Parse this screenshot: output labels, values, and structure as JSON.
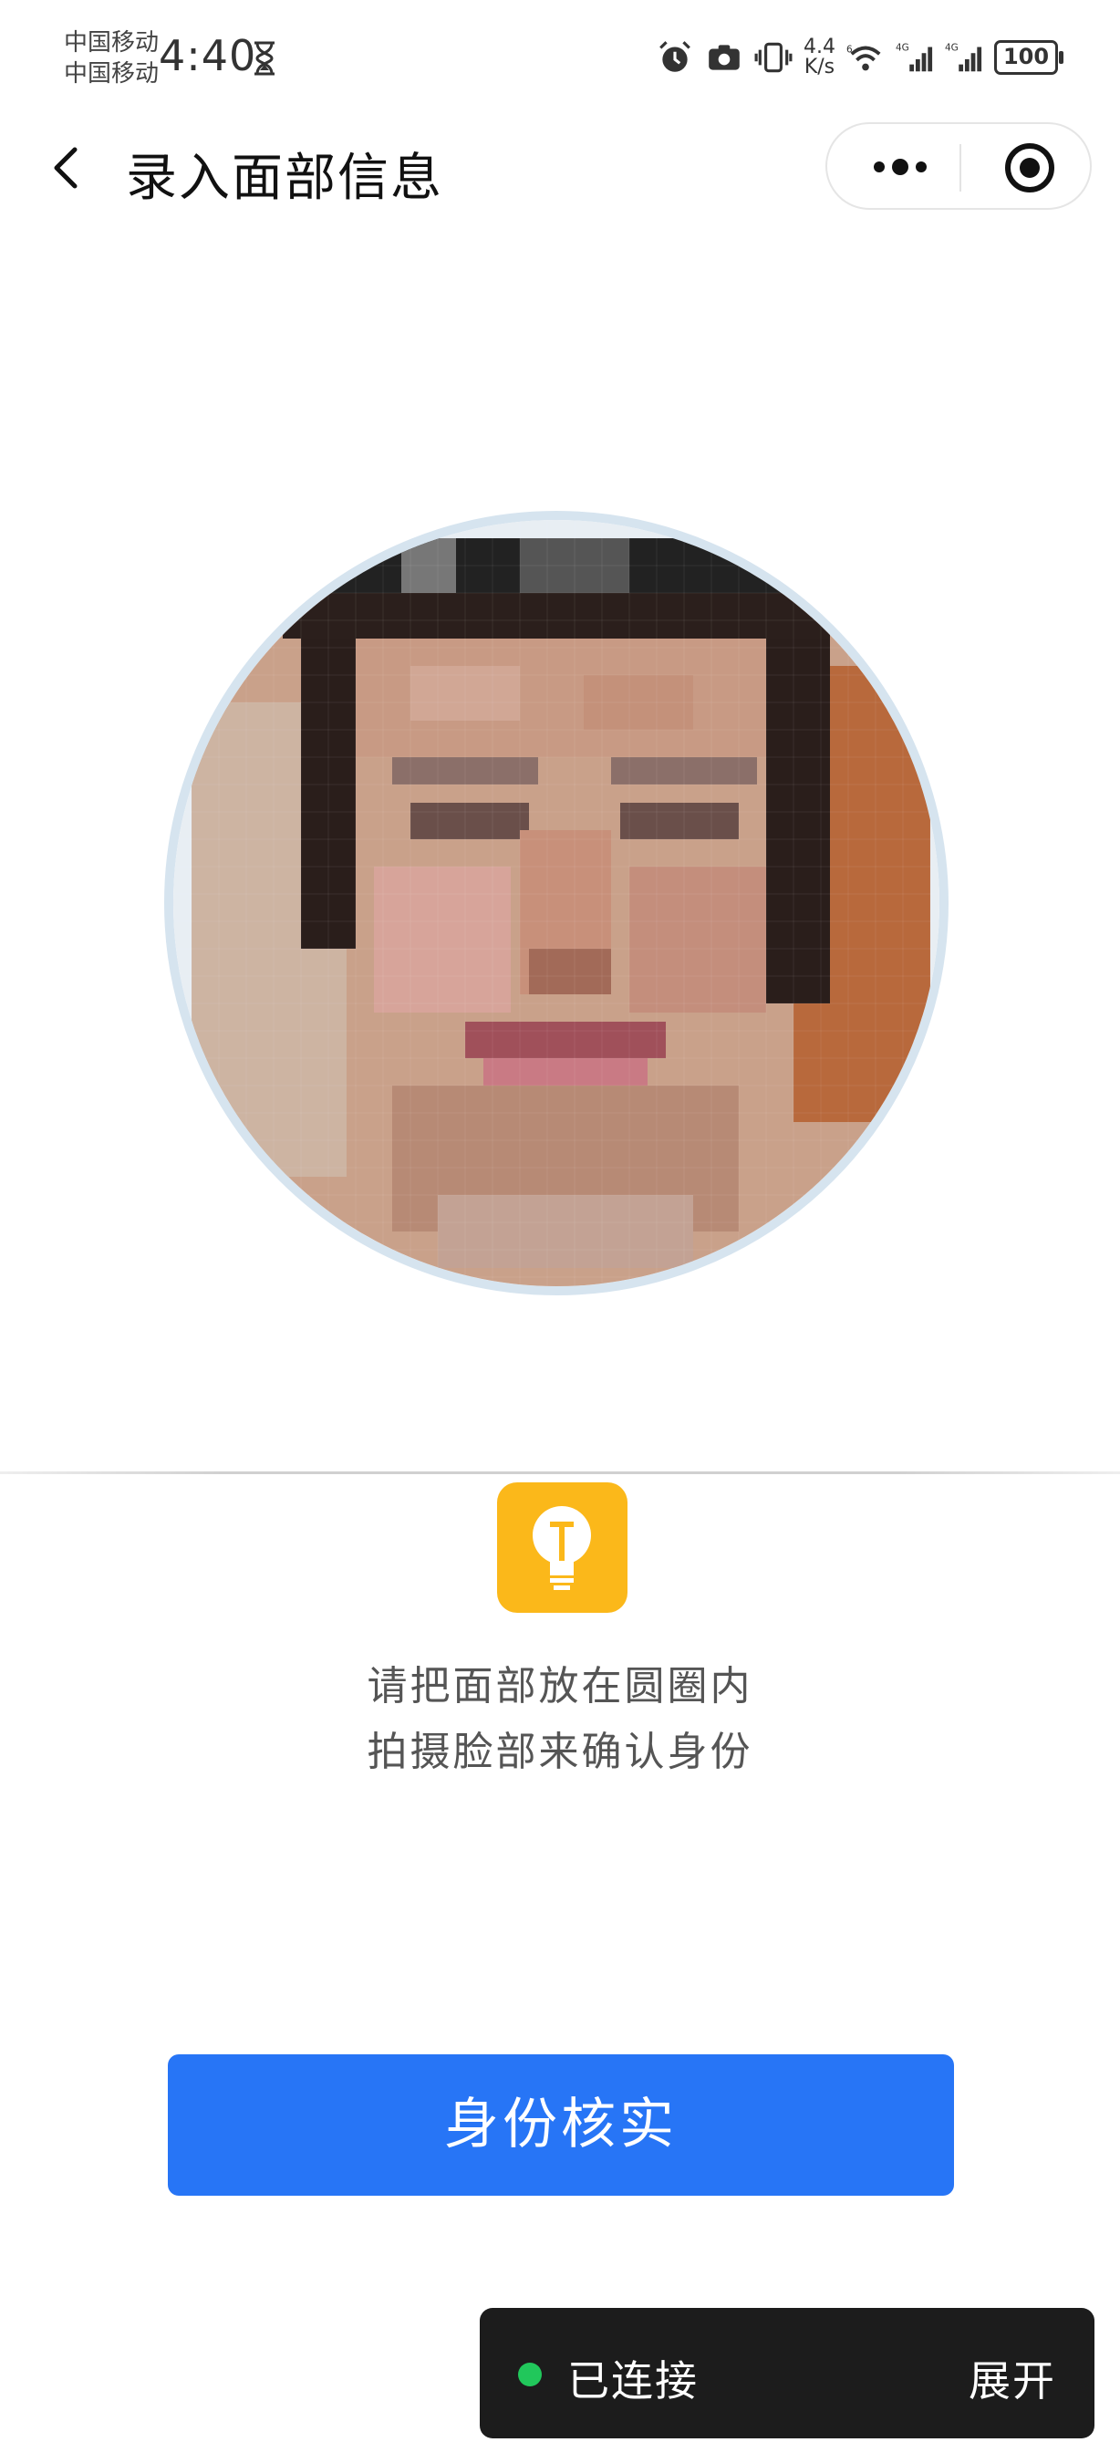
{
  "status_bar": {
    "carrier_1": "中国移动",
    "carrier_2": "中国移动",
    "time": "4:40",
    "net_speed_value": "4.4",
    "net_speed_unit": "K/s",
    "signal_1_label": "4G",
    "signal_2_label": "4G",
    "wifi_label": "6",
    "battery": "100"
  },
  "nav": {
    "title": "录入面部信息"
  },
  "tip": {
    "line1": "请把面部放在圆圈内",
    "line2": "拍摄脸部来确认身份"
  },
  "actions": {
    "verify_label": "身份核实"
  },
  "connection": {
    "status": "已连接",
    "expand_label": "展开",
    "status_color": "#21c75b"
  },
  "colors": {
    "primary": "#2775f6",
    "tip_icon": "#fbb81a",
    "ring": "#d6e4ef"
  }
}
